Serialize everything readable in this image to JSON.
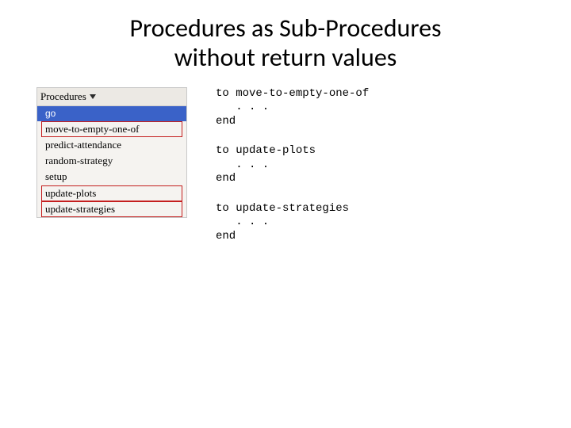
{
  "title_line1": "Procedures as Sub-Procedures",
  "title_line2": "without return values",
  "panel": {
    "header": "Procedures",
    "items": [
      {
        "label": "go",
        "selected": true,
        "boxed": false
      },
      {
        "label": "move-to-empty-one-of",
        "selected": false,
        "boxed": true
      },
      {
        "label": "predict-attendance",
        "selected": false,
        "boxed": false
      },
      {
        "label": "random-strategy",
        "selected": false,
        "boxed": false
      },
      {
        "label": "setup",
        "selected": false,
        "boxed": false
      },
      {
        "label": "update-plots",
        "selected": false,
        "boxed": true
      },
      {
        "label": "update-strategies",
        "selected": false,
        "boxed": true
      }
    ]
  },
  "code": {
    "b1_l1": "to move-to-empty-one-of",
    "b1_l2": "   . . .",
    "b1_l3": "end",
    "b2_l1": "to update-plots",
    "b2_l2": "   . . .",
    "b2_l3": "end",
    "b3_l1": "to update-strategies",
    "b3_l2": "   . . .",
    "b3_l3": "end"
  }
}
